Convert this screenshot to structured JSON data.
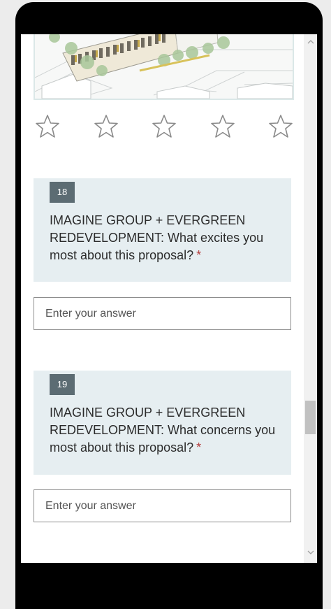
{
  "rating": {
    "stars": [
      {
        "name": "star-1"
      },
      {
        "name": "star-2"
      },
      {
        "name": "star-3"
      },
      {
        "name": "star-4"
      },
      {
        "name": "star-5"
      }
    ],
    "star_color": "#8a8a8a"
  },
  "questions": [
    {
      "number": "18",
      "text": "IMAGINE GROUP + EVERGREEN REDEVELOPMENT: What excites you most about this proposal?",
      "required_mark": "*",
      "answer_placeholder": "Enter your answer"
    },
    {
      "number": "19",
      "text": "IMAGINE GROUP + EVERGREEN REDEVELOPMENT: What concerns you most about this proposal?",
      "required_mark": "*",
      "answer_placeholder": "Enter your answer"
    }
  ],
  "scrollbar": {
    "up_icon": "chevron-up-icon",
    "down_icon": "chevron-down-icon"
  },
  "colors": {
    "question_bg": "#e6eef1",
    "number_badge_bg": "#5c6c73",
    "required": "#b33a3a"
  }
}
